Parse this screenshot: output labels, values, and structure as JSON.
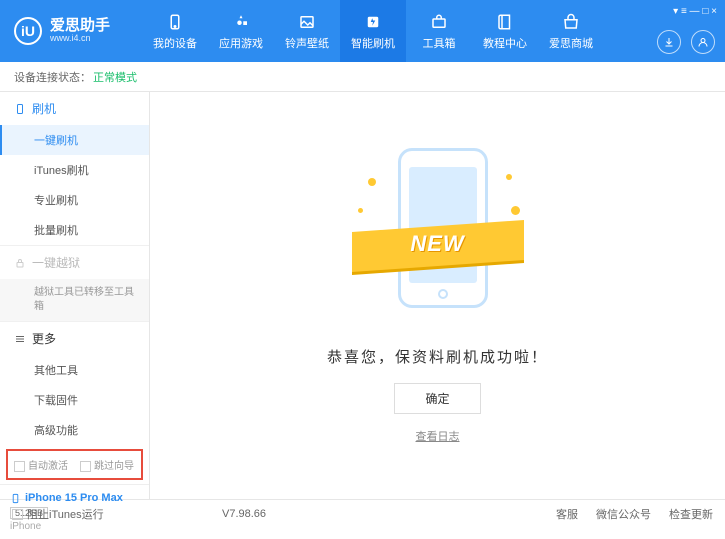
{
  "header": {
    "logo_letter": "iU",
    "app_name": "爱思助手",
    "app_url": "www.i4.cn",
    "nav": [
      {
        "label": "我的设备"
      },
      {
        "label": "应用游戏"
      },
      {
        "label": "铃声壁纸"
      },
      {
        "label": "智能刷机"
      },
      {
        "label": "工具箱"
      },
      {
        "label": "教程中心"
      },
      {
        "label": "爱思商城"
      }
    ],
    "top_icons": "▾  ≡  —  □  ×"
  },
  "status": {
    "label": "设备连接状态：",
    "value": "正常模式"
  },
  "sidebar": {
    "g1_title": "刷机",
    "g1_items": [
      "一键刷机",
      "iTunes刷机",
      "专业刷机",
      "批量刷机"
    ],
    "g2_title": "一键越狱",
    "g2_note": "越狱工具已转移至工具箱",
    "g3_title": "更多",
    "g3_items": [
      "其他工具",
      "下载固件",
      "高级功能"
    ],
    "chk1": "自动激活",
    "chk2": "跳过向导",
    "device_name": "iPhone 15 Pro Max",
    "device_cap": "512GB",
    "device_type": "iPhone"
  },
  "main": {
    "ribbon": "NEW",
    "success": "恭喜您，保资料刷机成功啦！",
    "ok": "确定",
    "log": "查看日志"
  },
  "footer": {
    "block_itunes": "阻止iTunes运行",
    "version": "V7.98.66",
    "links": [
      "客服",
      "微信公众号",
      "检查更新"
    ]
  }
}
